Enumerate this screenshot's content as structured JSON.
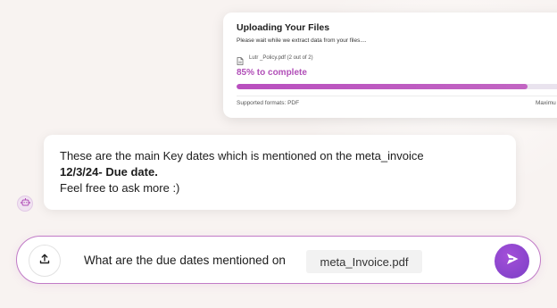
{
  "upload": {
    "title": "Uploading Your Files",
    "subtitle": "Please wait while we extract data from your  files....",
    "file_name": "Lutr _Policy.pdf (2 out of 2)",
    "progress_label": "85% to complete",
    "progress_fraction": 0.88,
    "supported_formats": "Supported formats: PDF",
    "max_size_label": "Maximu",
    "accent_color": "#b14fb8"
  },
  "bot_message": {
    "lines": [
      "These are the main Key dates which is mentioned on the meta_invoice",
      "12/3/24- Due date.",
      "Feel free to ask more :)"
    ],
    "avatar_icon": "robot-icon"
  },
  "composer": {
    "query_text": "What are the due dates mentioned on",
    "attached_file": "meta_Invoice.pdf",
    "upload_icon": "upload-icon",
    "send_icon": "send-icon",
    "border_color": "#c17bc7",
    "send_color": "#8a45cf"
  }
}
